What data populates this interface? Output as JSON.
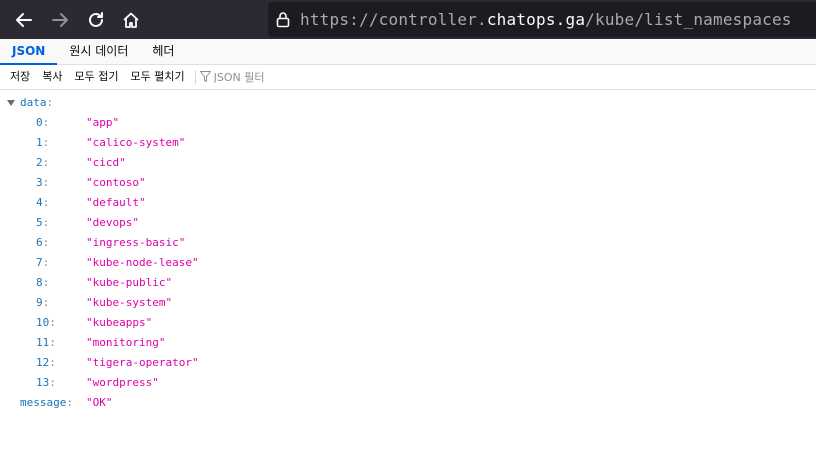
{
  "browser": {
    "url_prefix": "https://controller.",
    "url_host": "chatops.ga",
    "url_path": "/kube/list_namespaces"
  },
  "tabs": [
    {
      "label": "JSON",
      "selected": true
    },
    {
      "label": "원시 데이터",
      "selected": false
    },
    {
      "label": "헤더",
      "selected": false
    }
  ],
  "toolbar": {
    "save_label": "저장",
    "copy_label": "복사",
    "collapse_all_label": "모두 접기",
    "expand_all_label": "모두 펼치기",
    "filter_placeholder": "JSON 필터"
  },
  "tree": {
    "data_key": "data",
    "items": [
      {
        "index": "0",
        "value": "\"app\""
      },
      {
        "index": "1",
        "value": "\"calico-system\""
      },
      {
        "index": "2",
        "value": "\"cicd\""
      },
      {
        "index": "3",
        "value": "\"contoso\""
      },
      {
        "index": "4",
        "value": "\"default\""
      },
      {
        "index": "5",
        "value": "\"devops\""
      },
      {
        "index": "6",
        "value": "\"ingress-basic\""
      },
      {
        "index": "7",
        "value": "\"kube-node-lease\""
      },
      {
        "index": "8",
        "value": "\"kube-public\""
      },
      {
        "index": "9",
        "value": "\"kube-system\""
      },
      {
        "index": "10",
        "value": "\"kubeapps\""
      },
      {
        "index": "11",
        "value": "\"monitoring\""
      },
      {
        "index": "12",
        "value": "\"tigera-operator\""
      },
      {
        "index": "13",
        "value": "\"wordpress\""
      }
    ],
    "message_key": "message",
    "message_value": "\"OK\"",
    "colon": ":"
  },
  "colors": {
    "key": "#1a73b7",
    "string_value": "#dd00a9",
    "selected_tab": "#0060df",
    "browser_chrome": "#2b2a33"
  }
}
